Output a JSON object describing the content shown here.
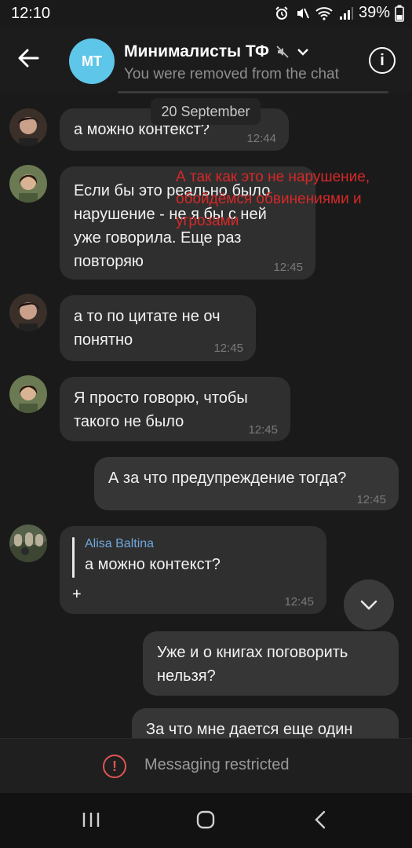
{
  "status_bar": {
    "time": "12:10",
    "battery": "39%"
  },
  "header": {
    "avatar_initials": "МТ",
    "title": "Минималисты ТФ",
    "subtitle": "You were removed from the chat"
  },
  "date_separator": "20 September",
  "messages": [
    {
      "text": "а можно контекст?",
      "time": "12:44"
    },
    {
      "text": "Если бы это реально было\nнарушение - не я бы с ней\nуже говорила. Еще раз\nповторяю",
      "time": "12:45"
    },
    {
      "text": "а то по цитате не оч\nпонятно",
      "time": "12:45"
    },
    {
      "text": "Я просто говорю, чтобы\nтакого не было",
      "time": "12:45"
    },
    {
      "text": "А за что предупреждение тогда?",
      "time": "12:45"
    },
    {
      "reply_author": "Alisa Baltina",
      "reply_text": "а можно контекст?",
      "extra": "+",
      "time": "12:45"
    },
    {
      "text": "Уже и о книгах поговорить\nнельзя?",
      "time": ""
    },
    {
      "text": "За что мне дается еще один",
      "time": ""
    }
  ],
  "annotation": "А так как это не нарушение,\nобойдёмся обвинениями и\nугрозами",
  "restricted": {
    "label": "Messaging restricted"
  },
  "colors": {
    "accent": "#5ec6e8",
    "annotation": "#d62828",
    "warning": "#e05555",
    "reply_author": "#6fa8dc"
  }
}
